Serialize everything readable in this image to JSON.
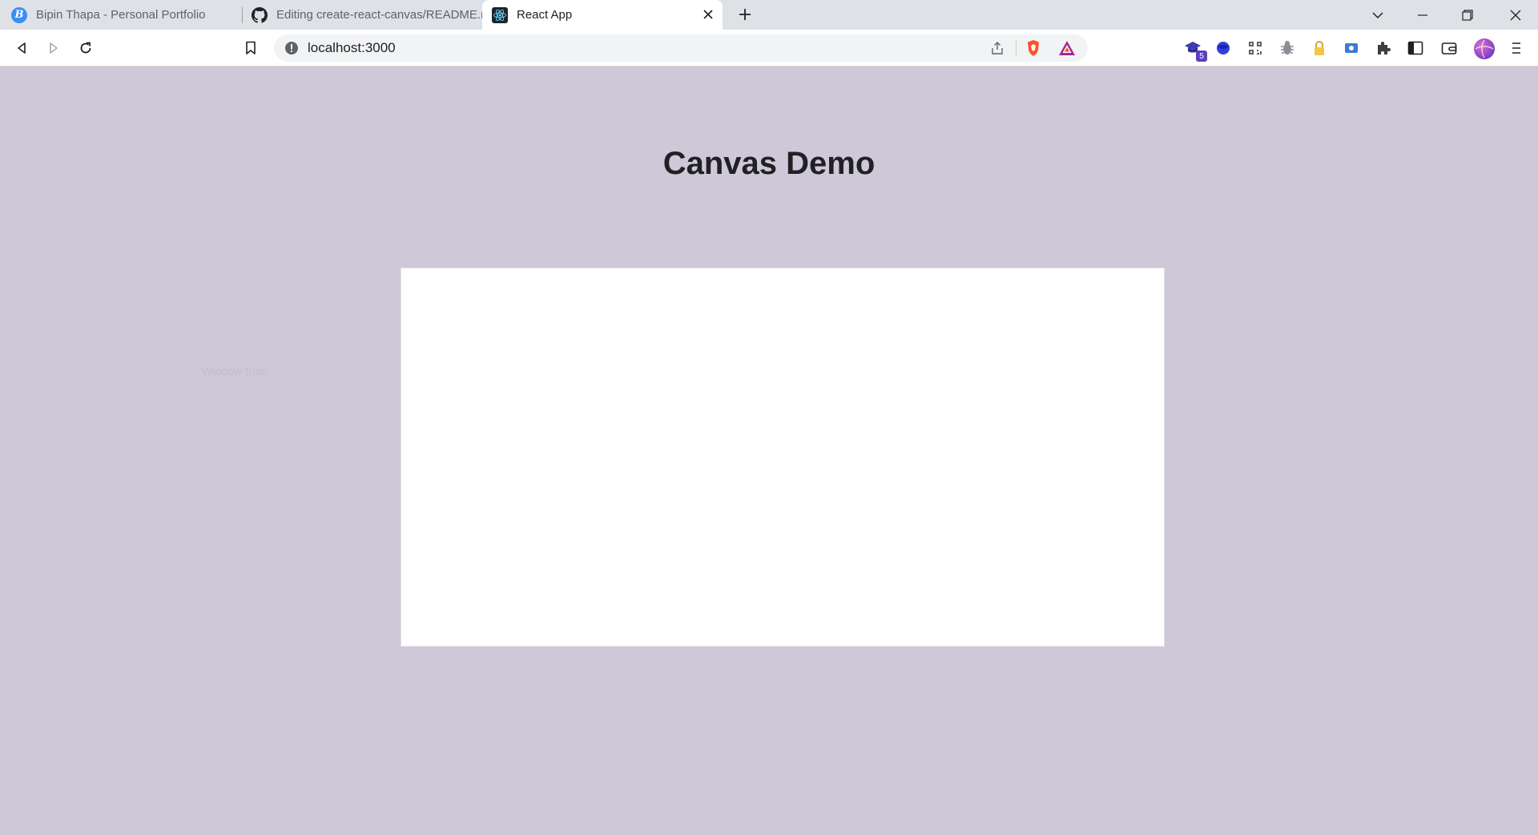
{
  "browser": {
    "tabs": [
      {
        "title": "Bipin Thapa - Personal Portfolio",
        "icon": "bipin-b-favicon",
        "active": false
      },
      {
        "title": "Editing create-react-canvas/README.md",
        "icon": "github-icon",
        "active": false
      },
      {
        "title": "React App",
        "icon": "react-icon",
        "active": true
      }
    ],
    "address": {
      "url": "localhost:3000",
      "security_icon": "info-icon"
    },
    "extensions": {
      "badge_count": "5"
    }
  },
  "page": {
    "title": "Canvas Demo",
    "overlay_text": "Window Snip"
  },
  "colors": {
    "page_background": "#cfc8d8",
    "canvas_background": "#ffffff",
    "tabstrip_background": "#dee1e6"
  }
}
